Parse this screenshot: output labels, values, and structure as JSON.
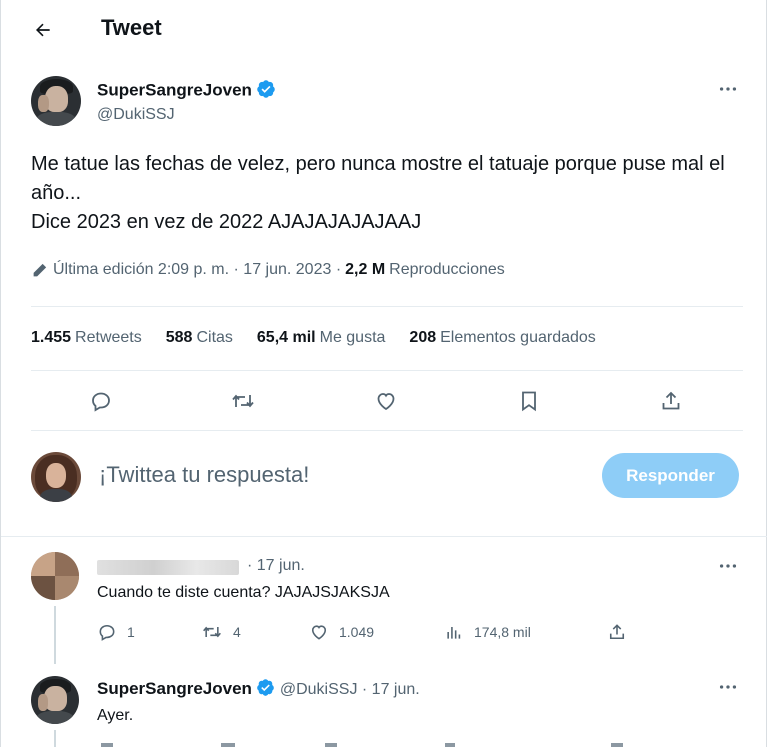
{
  "header": {
    "title": "Tweet"
  },
  "tweet": {
    "author_name": "SuperSangreJoven",
    "author_handle": "@DukiSSJ",
    "text_line1": "Me tatue las fechas de velez, pero nunca mostre el tatuaje porque puse mal el año...",
    "text_line2": "Dice 2023 en vez de 2022 AJAJAJAJAJAAJ",
    "edited_label": "Última edición 2:09 p. m. · 17 jun. 2023 ·",
    "views_count": "2,2 M",
    "views_label": "Reproducciones",
    "stats": {
      "retweets_count": "1.455",
      "retweets_label": "Retweets",
      "quotes_count": "588",
      "quotes_label": "Citas",
      "likes_count": "65,4 mil",
      "likes_label": "Me gusta",
      "bookmarks_count": "208",
      "bookmarks_label": "Elementos guardados"
    }
  },
  "composer": {
    "placeholder": "¡Twittea tu respuesta!",
    "button_label": "Responder"
  },
  "replies": [
    {
      "date": "· 17 jun.",
      "text": "Cuando te diste cuenta? JAJAJSJAKSJA",
      "reply_count": "1",
      "retweet_count": "4",
      "like_count": "1.049",
      "view_count": "174,8 mil"
    },
    {
      "author_name": "SuperSangreJoven",
      "author_handle": "@DukiSSJ",
      "date": "· 17 jun.",
      "text": "Ayer."
    }
  ],
  "colors": {
    "accent": "#1d9bf0",
    "button_disabled": "#8ecdf7",
    "secondary_text": "#536471"
  },
  "icons": [
    "back-arrow-icon",
    "verified-badge-icon",
    "more-icon",
    "pencil-icon",
    "reply-icon",
    "retweet-icon",
    "like-icon",
    "bookmark-icon",
    "share-icon",
    "views-icon"
  ]
}
